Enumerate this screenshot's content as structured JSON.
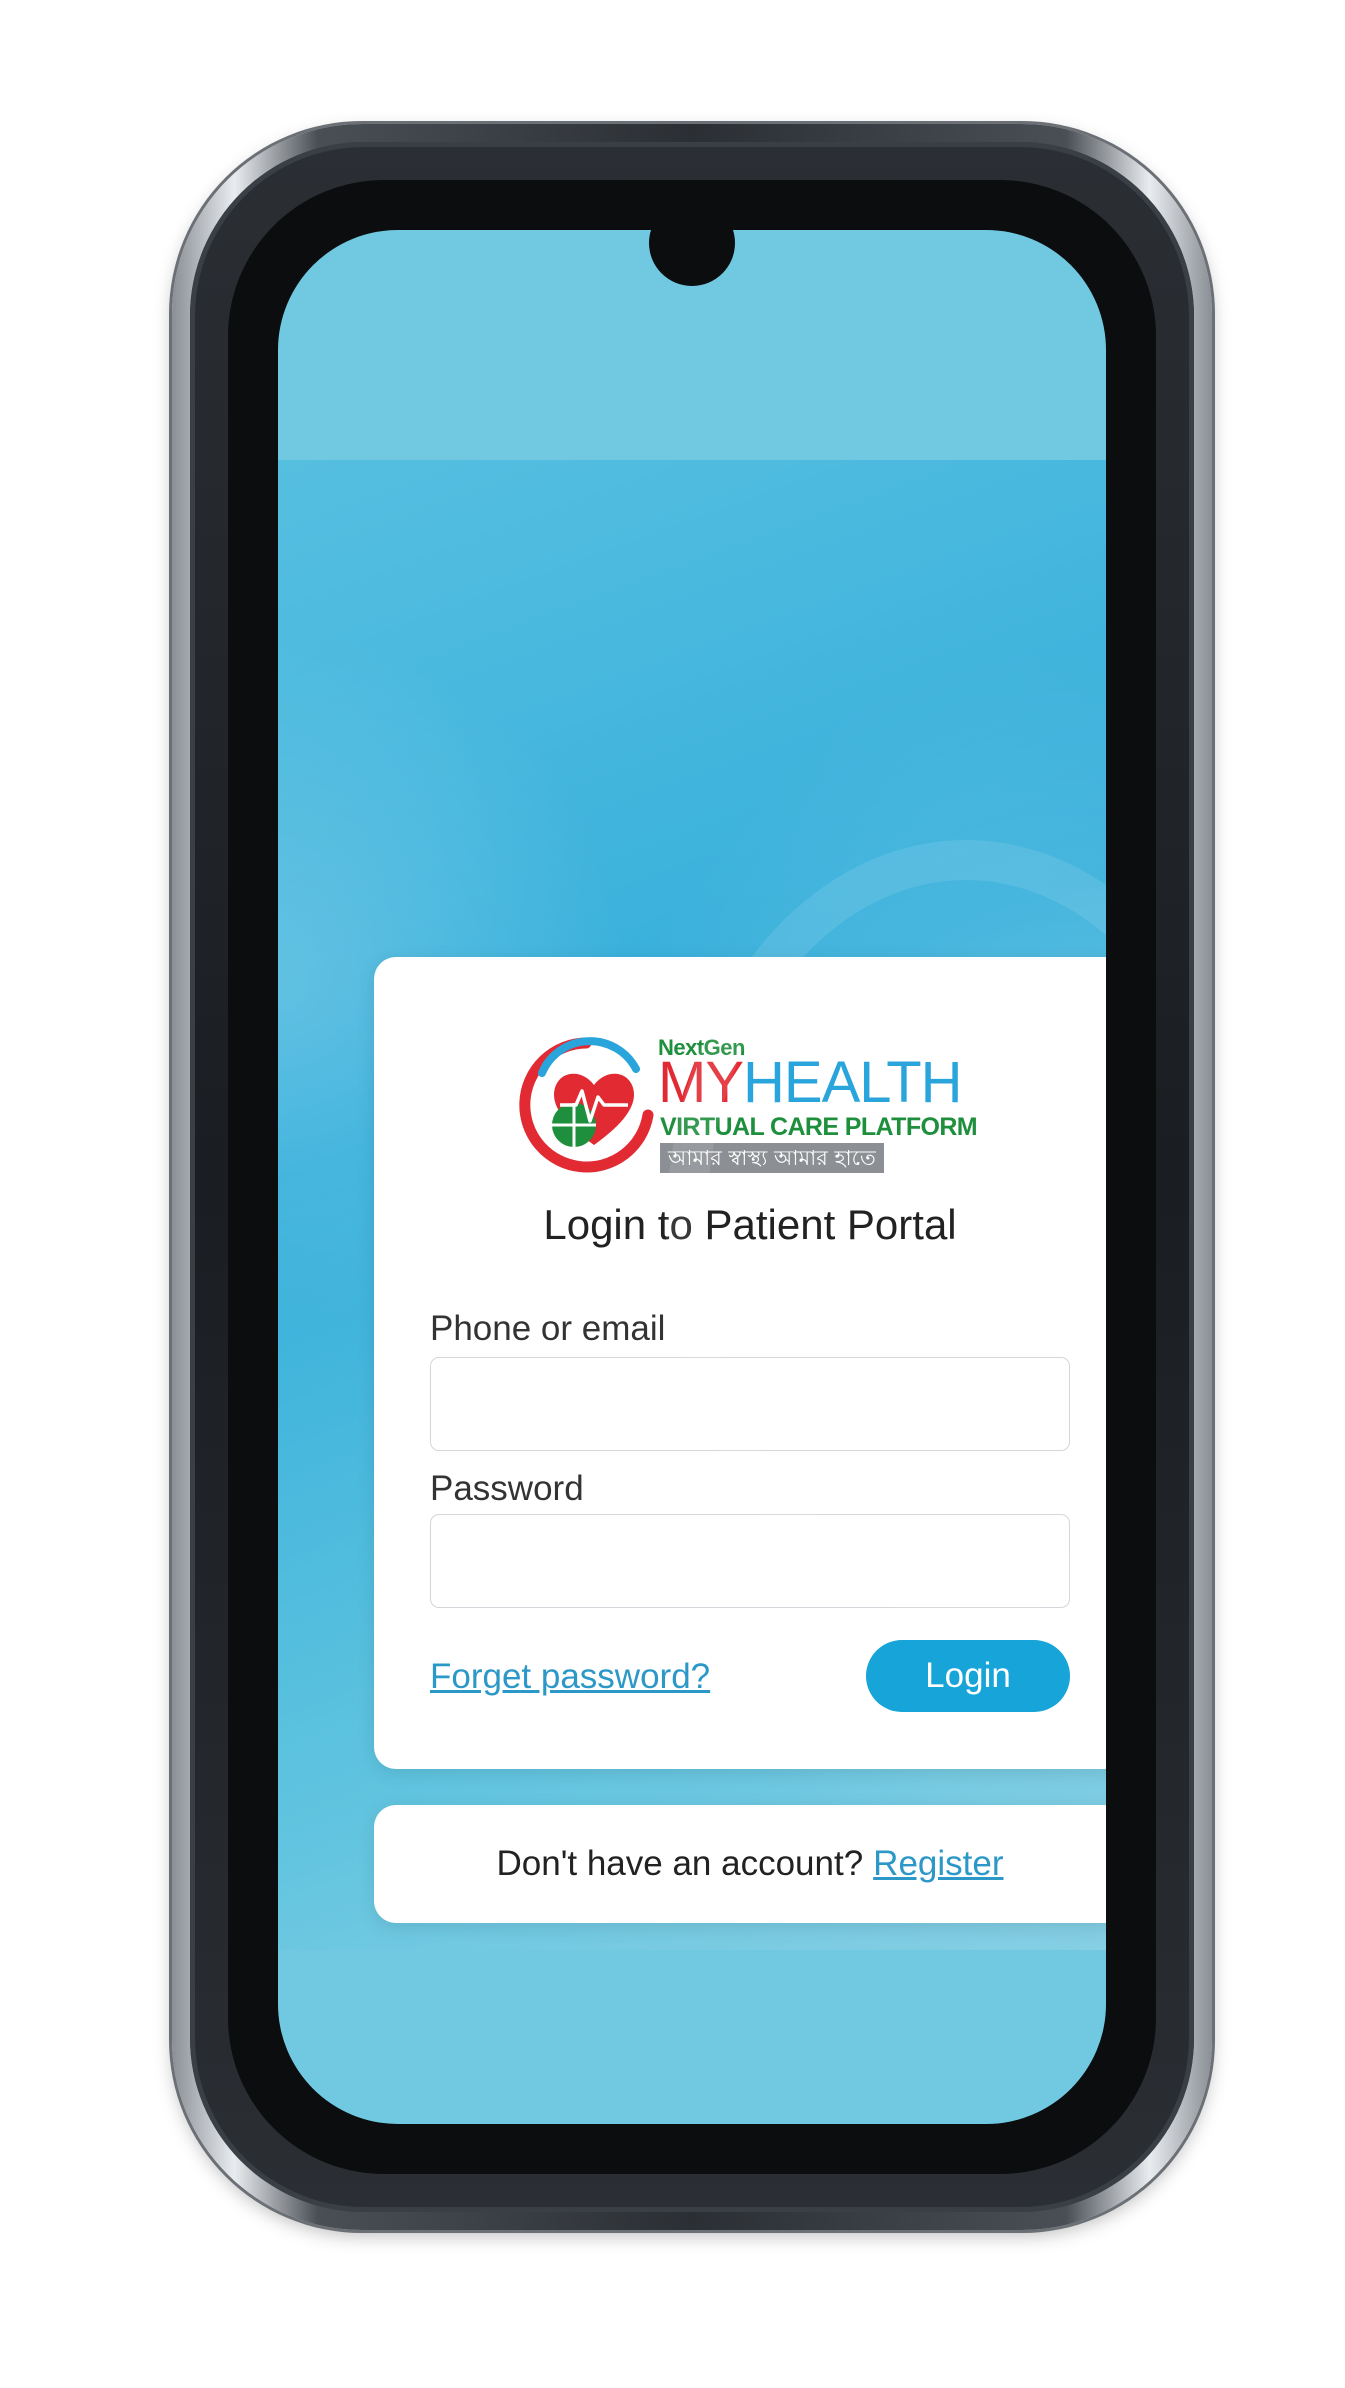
{
  "logo": {
    "nextgen": "NextGen",
    "brand_my": "MY",
    "brand_health": "HEALTH",
    "subtitle": "VIRTUAL CARE PLATFORM",
    "tagline_bn": "আমার স্বাস্থ্য আমার হাতে",
    "icon": "heart-globe-logo-icon"
  },
  "login": {
    "title": "Login to Patient Portal",
    "phone_label": "Phone or email",
    "phone_value": "",
    "password_label": "Password",
    "password_value": "",
    "forgot_link": "Forget password?",
    "login_button": "Login"
  },
  "register": {
    "prompt": "Don't have an account?",
    "link": "Register"
  },
  "colors": {
    "screen_bg": "#70c9e1",
    "accent": "#17a4d9",
    "link": "#2c98c8",
    "brand_red": "#e22a33",
    "brand_green": "#1e8f3c",
    "brand_blue": "#2aa5dc"
  }
}
